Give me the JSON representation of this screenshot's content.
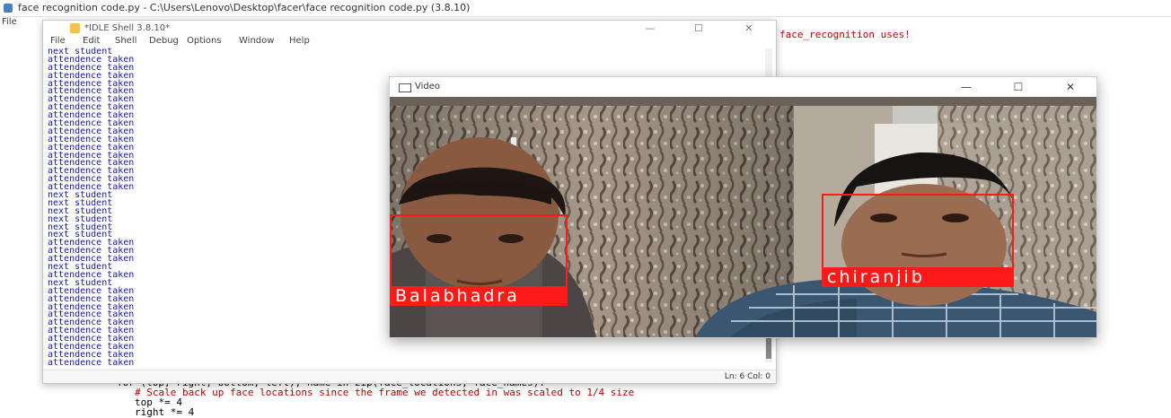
{
  "editor": {
    "title": "face recognition code.py - C:\\Users\\Lenovo\\Desktop\\facer\\face recognition code.py (3.8.10)",
    "menu_file": "File",
    "code_top": "face_recognition uses!",
    "code_lines": [
      "for (top, right, bottom, left), name in zip(face_locations, face_names):",
      "# Scale back up face locations since the frame we detected in was scaled to 1/4 size",
      "top *= 4",
      "right *= 4"
    ]
  },
  "shell": {
    "title": "*IDLE Shell 3.8.10*",
    "menu": [
      "File",
      "Edit",
      "Shell",
      "Debug",
      "Options",
      "Window",
      "Help"
    ],
    "output": [
      "next student",
      "attendence taken",
      "attendence taken",
      "attendence taken",
      "attendence taken",
      "attendence taken",
      "attendence taken",
      "attendence taken",
      "attendence taken",
      "attendence taken",
      "attendence taken",
      "attendence taken",
      "attendence taken",
      "attendence taken",
      "attendence taken",
      "attendence taken",
      "attendence taken",
      "attendence taken",
      "next student",
      "next student",
      "next student",
      "next student",
      "next student",
      "next student",
      "attendence taken",
      "attendence taken",
      "attendence taken",
      "next student",
      "attendence taken",
      "next student",
      "attendence taken",
      "attendence taken",
      "attendence taken",
      "attendence taken",
      "attendence taken",
      "attendence taken",
      "attendence taken",
      "attendence taken",
      "attendence taken",
      "attendence taken"
    ],
    "status": "Ln: 6  Col: 0"
  },
  "video": {
    "title": "Video",
    "faces": [
      "Balabhadra",
      "chiranjib"
    ],
    "box_color": "#ff1a1a"
  },
  "window_controls": {
    "minimize": "—",
    "maximize": "☐",
    "close": "✕"
  }
}
